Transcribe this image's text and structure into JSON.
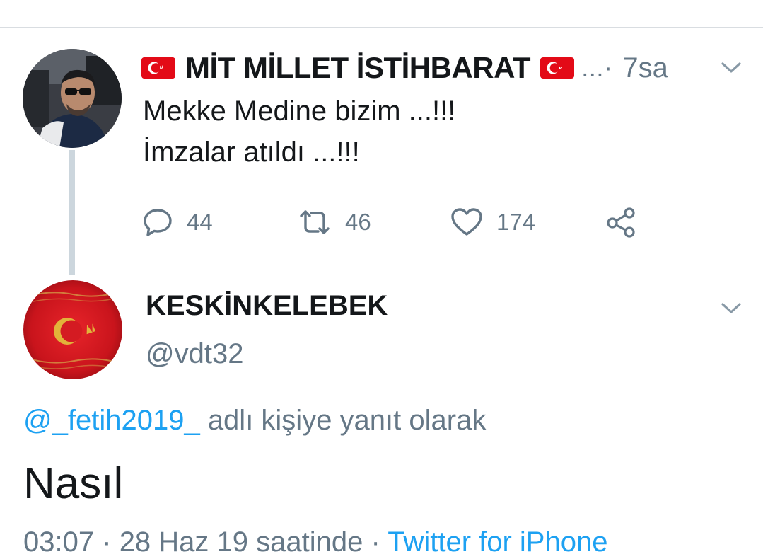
{
  "parent_tweet": {
    "display_name": "MİT MİLLET İSTİHBARAT",
    "ellipsis": "...",
    "separator": "·",
    "time": "7sa",
    "text_lines": [
      "Mekke Medine bizim ...!!!",
      "İmzalar atıldı ...!!!"
    ],
    "reply_count": "44",
    "retweet_count": "46",
    "like_count": "174",
    "icons": {
      "reply": "reply-bubble-icon",
      "retweet": "retweet-icon",
      "like": "heart-icon",
      "share": "share-icon",
      "menu": "chevron-down-icon"
    }
  },
  "reply_tweet": {
    "display_name": "KESKİNKELEBEK",
    "handle": "@vdt32",
    "replying_to_mention": "@_fetih2019_",
    "replying_to_text": "adlı kişiye yanıt olarak",
    "text": "Nasıl",
    "time": "03:07",
    "dot": "·",
    "date_text": "28 Haz 19 saatinde",
    "source": "Twitter for iPhone"
  },
  "colors": {
    "link": "#1da1f2",
    "secondary_text": "#657786",
    "primary_text": "#14171a",
    "thread_line": "#ccd6dd",
    "flag_red": "#e30a17"
  }
}
